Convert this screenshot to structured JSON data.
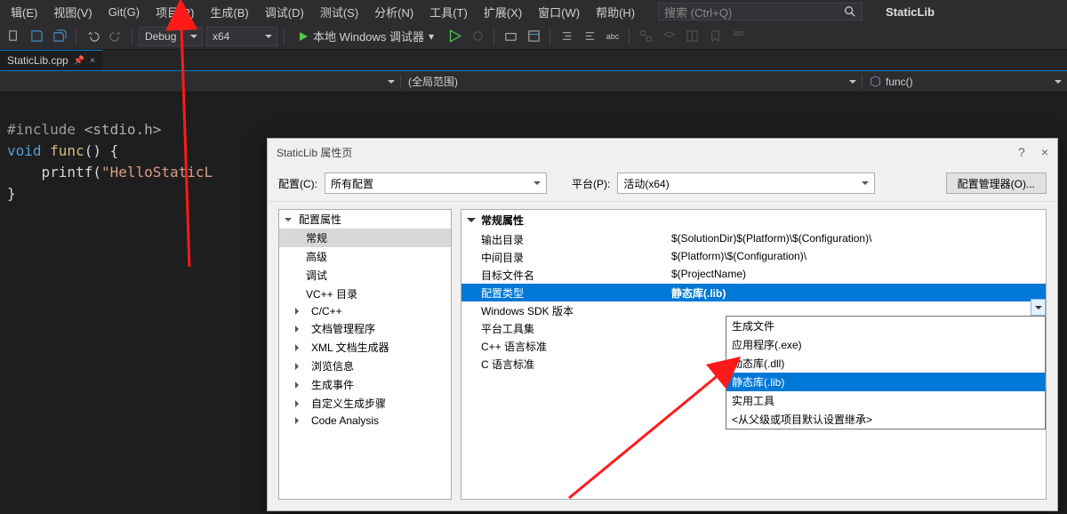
{
  "menu": {
    "items": [
      "辑(E)",
      "视图(V)",
      "Git(G)",
      "项目(P)",
      "生成(B)",
      "调试(D)",
      "测试(S)",
      "分析(N)",
      "工具(T)",
      "扩展(X)",
      "窗口(W)",
      "帮助(H)"
    ],
    "search_placeholder": "搜索 (Ctrl+Q)",
    "app_title": "StaticLib"
  },
  "toolbar": {
    "config": "Debug",
    "platform": "x64",
    "run_label": "本地 Windows 调试器"
  },
  "tab": {
    "filename": "StaticLib.cpp"
  },
  "scope": {
    "global": "(全局范围)",
    "func": "func()"
  },
  "code": {
    "l1_a": "#include ",
    "l1_b": "<stdio.h>",
    "l2_a": "void",
    "l2_b": " func",
    "l2_c": "() {",
    "l3_a": "    printf(",
    "l3_b": "\"HelloStaticL",
    "l4": "}"
  },
  "dialog": {
    "title": "StaticLib 属性页",
    "close": "×",
    "help": "?",
    "config_label": "配置(C):",
    "config_value": "所有配置",
    "platform_label": "平台(P):",
    "platform_value": "活动(x64)",
    "config_mgr": "配置管理器(O)...",
    "tree": {
      "root": "配置属性",
      "items": [
        "常规",
        "高级",
        "调试",
        "VC++ 目录",
        "C/C++",
        "文档管理程序",
        "XML 文档生成器",
        "浏览信息",
        "生成事件",
        "自定义生成步骤",
        "Code Analysis"
      ]
    },
    "grid": {
      "section": "常规属性",
      "rows": [
        {
          "k": "输出目录",
          "v": "$(SolutionDir)$(Platform)\\$(Configuration)\\"
        },
        {
          "k": "中间目录",
          "v": "$(Platform)\\$(Configuration)\\"
        },
        {
          "k": "目标文件名",
          "v": "$(ProjectName)"
        },
        {
          "k": "配置类型",
          "v": "静态库(.lib)"
        },
        {
          "k": "Windows SDK 版本",
          "v": ""
        },
        {
          "k": "平台工具集",
          "v": ""
        },
        {
          "k": "C++ 语言标准",
          "v": ""
        },
        {
          "k": "C 语言标准",
          "v": ""
        }
      ]
    },
    "dropdown": {
      "items": [
        "生成文件",
        "应用程序(.exe)",
        "动态库(.dll)",
        "静态库(.lib)",
        "实用工具",
        "<从父级或项目默认设置继承>"
      ],
      "selected_index": 3
    }
  }
}
